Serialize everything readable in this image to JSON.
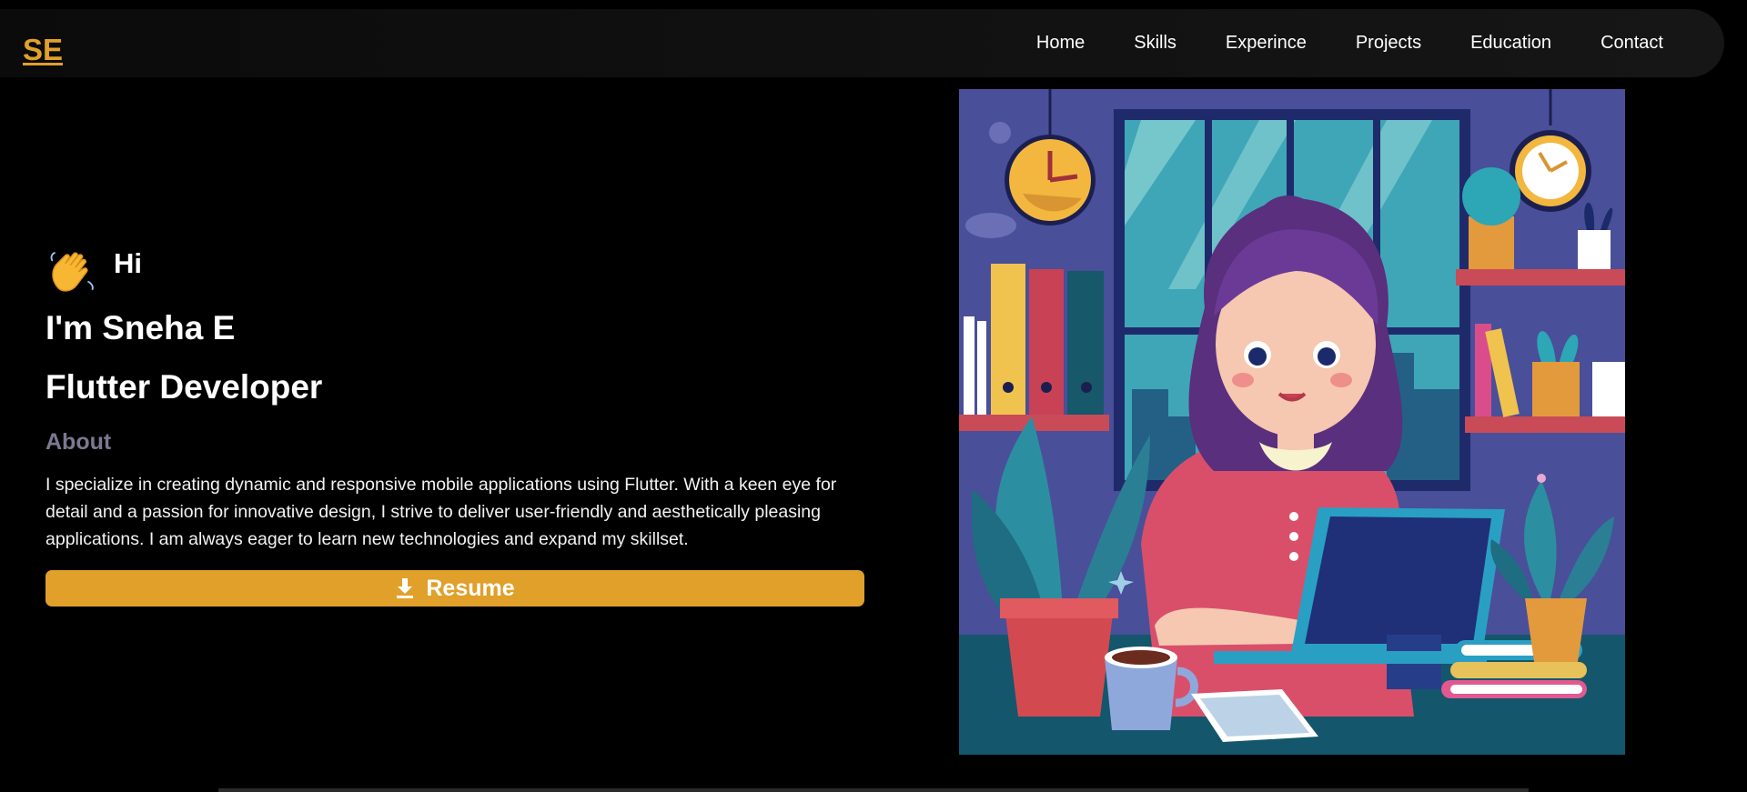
{
  "header": {
    "logo_text": "SE",
    "nav": [
      {
        "label": "Home"
      },
      {
        "label": "Skills"
      },
      {
        "label": "Experince"
      },
      {
        "label": "Projects"
      },
      {
        "label": "Education"
      },
      {
        "label": "Contact"
      }
    ]
  },
  "hero": {
    "greeting_icon": "waving-hand-icon",
    "greeting": "Hi",
    "name_line": "I'm Sneha E",
    "role": "Flutter Developer",
    "about_title": "About",
    "about_text": "I specialize in creating dynamic and responsive mobile applications using Flutter. With a keen eye for detail and a passion for innovative design, I strive to deliver user-friendly and aesthetically pleasing applications. I am always eager to learn new technologies and expand my skillset.",
    "resume_icon": "download-icon",
    "resume_label": "Resume"
  },
  "illustration": {
    "subject": "woman-working-at-desk-illustration"
  },
  "colors": {
    "accent": "#e0a02a",
    "background": "#000000",
    "muted_heading": "#7b7890",
    "text": "#ffffff"
  }
}
